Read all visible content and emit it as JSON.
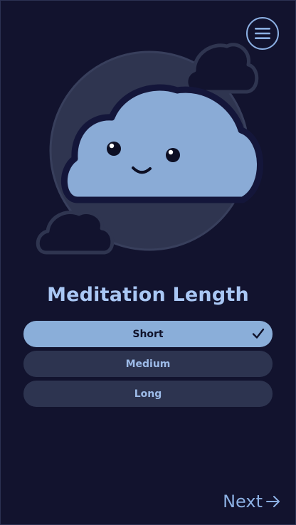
{
  "header": {
    "menu_icon": "hamburger-menu-icon"
  },
  "hero": {
    "illustration": "smiling-cloud-illustration"
  },
  "main": {
    "title": "Meditation Length",
    "options": [
      {
        "label": "Short",
        "selected": true
      },
      {
        "label": "Medium",
        "selected": false
      },
      {
        "label": "Long",
        "selected": false
      }
    ]
  },
  "footer": {
    "next_label": "Next",
    "next_icon": "arrow-right-icon"
  },
  "colors": {
    "background": "#12132e",
    "accent": "#8cb0e3",
    "selected_fill": "#8aaed9",
    "unselected_fill": "#2d3450"
  }
}
